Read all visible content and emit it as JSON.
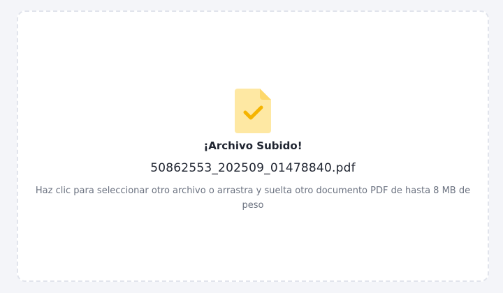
{
  "upload": {
    "status_title": "¡Archivo Subido!",
    "file_name": "50862553_202509_01478840.pdf",
    "hint": "Haz clic para seleccionar otro archivo o arrastra y suelta otro documento PDF de hasta 8 MB de peso",
    "icon": "file-check-icon"
  },
  "colors": {
    "icon_body": "#fee8a3",
    "icon_fold": "#fdd86b",
    "icon_check": "#f5b400",
    "border": "#e1e4ec"
  }
}
